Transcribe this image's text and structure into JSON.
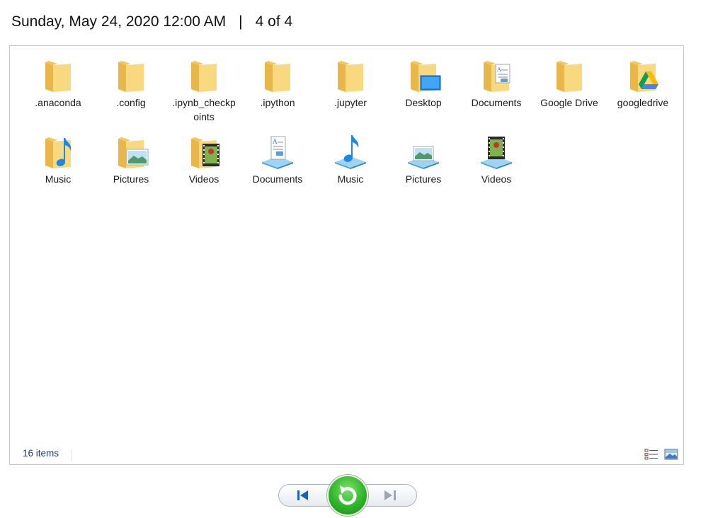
{
  "header": {
    "datetime": "Sunday, May 24, 2020 12:00 AM",
    "separator": "|",
    "page_indicator": "4 of 4"
  },
  "items": [
    {
      "label": ".anaconda",
      "icon": "folder-icon"
    },
    {
      "label": ".config",
      "icon": "folder-icon"
    },
    {
      "label": ".ipynb_checkpoints",
      "icon": "folder-icon"
    },
    {
      "label": ".ipython",
      "icon": "folder-icon"
    },
    {
      "label": ".jupyter",
      "icon": "folder-icon"
    },
    {
      "label": "Desktop",
      "icon": "desktop-folder-icon"
    },
    {
      "label": "Documents",
      "icon": "documents-folder-icon"
    },
    {
      "label": "Google Drive",
      "icon": "folder-icon"
    },
    {
      "label": "googledrive",
      "icon": "google-drive-folder-icon"
    },
    {
      "label": "Music",
      "icon": "music-folder-icon"
    },
    {
      "label": "Pictures",
      "icon": "pictures-folder-icon"
    },
    {
      "label": "Videos",
      "icon": "videos-folder-icon"
    },
    {
      "label": "Documents",
      "icon": "documents-library-icon"
    },
    {
      "label": "Music",
      "icon": "music-library-icon"
    },
    {
      "label": "Pictures",
      "icon": "pictures-library-icon"
    },
    {
      "label": "Videos",
      "icon": "videos-library-icon"
    }
  ],
  "status": {
    "item_count": "16 items"
  },
  "colors": {
    "folder": "#f6d67a",
    "accent_blue": "#1e88e5",
    "restore_green": "#2fb52a"
  }
}
